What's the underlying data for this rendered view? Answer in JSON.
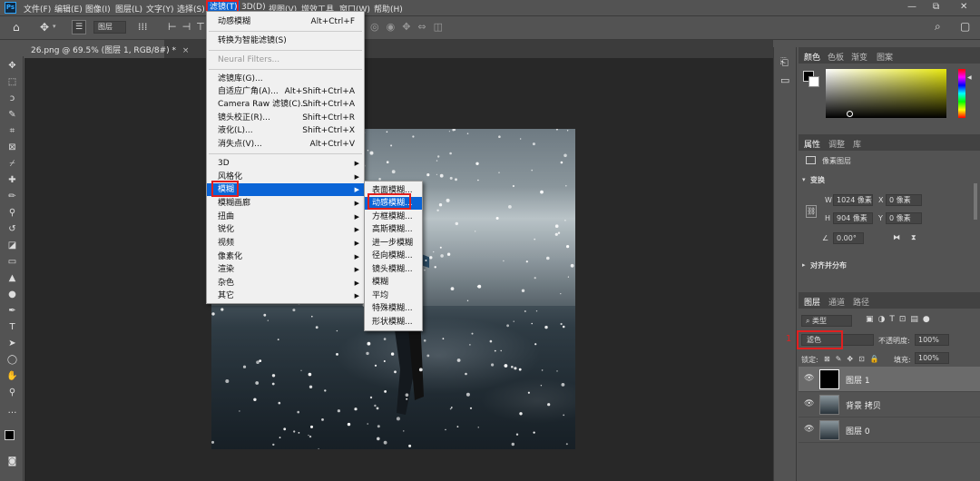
{
  "app": {
    "logo": "Ps"
  },
  "menubar": {
    "items": [
      "文件(F)",
      "编辑(E)",
      "图像(I)",
      "图层(L)",
      "文字(Y)",
      "选择(S)",
      "滤镜(T)",
      "3D(D)",
      "视图(V)",
      "增效工具",
      "窗口(W)",
      "帮助(H)"
    ]
  },
  "window_controls": {
    "minimize": "—",
    "restore": "⧉",
    "close": "✕"
  },
  "options_bar": {
    "layer_select": "图层"
  },
  "document_tab": {
    "label": "26.png @ 69.5% (图层 1, RGB/8#) *",
    "close": "×"
  },
  "filter_menu": {
    "items": [
      {
        "label": "动感模糊",
        "shortcut": "Alt+Ctrl+F"
      },
      {
        "label": "转换为智能滤镜(S)",
        "shortcut": ""
      },
      {
        "label": "Neural Filters...",
        "shortcut": "",
        "disabled": true
      },
      {
        "label": "滤镜库(G)...",
        "shortcut": ""
      },
      {
        "label": "自适应广角(A)...",
        "shortcut": "Alt+Shift+Ctrl+A"
      },
      {
        "label": "Camera Raw 滤镜(C)...",
        "shortcut": "Shift+Ctrl+A"
      },
      {
        "label": "镜头校正(R)...",
        "shortcut": "Shift+Ctrl+R"
      },
      {
        "label": "液化(L)...",
        "shortcut": "Shift+Ctrl+X"
      },
      {
        "label": "消失点(V)...",
        "shortcut": "Alt+Ctrl+V"
      },
      {
        "label": "3D",
        "sub": true
      },
      {
        "label": "风格化",
        "sub": true
      },
      {
        "label": "模糊",
        "sub": true,
        "highlighted": true
      },
      {
        "label": "模糊画廊",
        "sub": true
      },
      {
        "label": "扭曲",
        "sub": true
      },
      {
        "label": "锐化",
        "sub": true
      },
      {
        "label": "视频",
        "sub": true
      },
      {
        "label": "像素化",
        "sub": true
      },
      {
        "label": "渲染",
        "sub": true
      },
      {
        "label": "杂色",
        "sub": true
      },
      {
        "label": "其它",
        "sub": true
      }
    ]
  },
  "blur_submenu": {
    "items": [
      {
        "label": "表面模糊..."
      },
      {
        "label": "动感模糊...",
        "highlighted": true
      },
      {
        "label": "方框模糊..."
      },
      {
        "label": "高斯模糊..."
      },
      {
        "label": "进一步模糊"
      },
      {
        "label": "径向模糊..."
      },
      {
        "label": "镜头模糊..."
      },
      {
        "label": "模糊"
      },
      {
        "label": "平均"
      },
      {
        "label": "特殊模糊..."
      },
      {
        "label": "形状模糊..."
      }
    ]
  },
  "color_panel": {
    "tabs": [
      "颜色",
      "色板",
      "渐变",
      "图案"
    ],
    "active": 0
  },
  "properties_panel": {
    "tabs": [
      "属性",
      "调整",
      "库"
    ],
    "type_label": "像素图层",
    "transform_header": "变换",
    "w_label": "W",
    "w_value": "1024 像素",
    "h_label": "H",
    "h_value": "904 像素",
    "x_label": "X",
    "x_value": "0 像素",
    "y_label": "Y",
    "y_value": "0 像素",
    "angle_value": "0.00°",
    "align_header": "对齐并分布"
  },
  "layers_panel": {
    "tabs": [
      "图层",
      "通道",
      "路径"
    ],
    "filter_kind": "类型",
    "blend_mode": "滤色",
    "opacity_label": "不透明度:",
    "opacity_value": "100%",
    "lock_label": "锁定:",
    "fill_label": "填充:",
    "fill_value": "100%",
    "annotation": "1",
    "layers": [
      {
        "name": "图层 1",
        "selected": true
      },
      {
        "name": "背景 拷贝",
        "selected": false
      },
      {
        "name": "图层 0",
        "selected": false
      }
    ]
  },
  "colors": {
    "highlight": "#0a64d6",
    "annotation_red": "#e02020",
    "panel_bg": "#535353"
  }
}
